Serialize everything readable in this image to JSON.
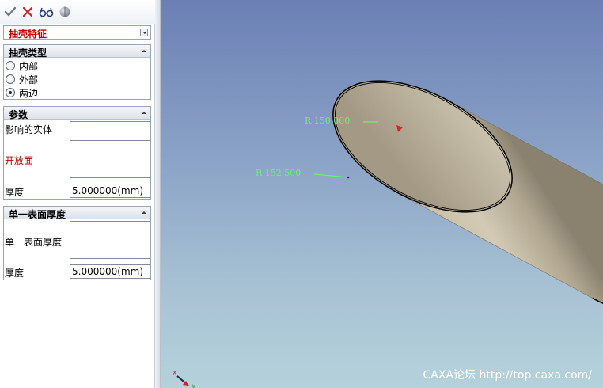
{
  "toolbar": {
    "buttons": [
      {
        "icon": "check-icon",
        "color": "#6b7a87"
      },
      {
        "icon": "close-icon",
        "color": "#cc2222"
      },
      {
        "icon": "preview-glasses-icon",
        "color": "#1e3c8a"
      },
      {
        "icon": "shade-sphere-icon",
        "color": "#8a8f99"
      }
    ]
  },
  "feature": {
    "title": "抽壳特征"
  },
  "shell_type": {
    "header": "抽壳类型",
    "options": [
      {
        "label": "内部",
        "selected": false
      },
      {
        "label": "外部",
        "selected": false
      },
      {
        "label": "两边",
        "selected": true
      }
    ]
  },
  "params": {
    "header": "参数",
    "affected_label": "影响的实体",
    "affected_value": "",
    "open_face_label": "开放面",
    "open_face_value": "",
    "thickness_label": "厚度",
    "thickness_value": "5.000000(mm)"
  },
  "single_surface": {
    "header": "单一表面厚度",
    "surface_label": "单一表面厚度",
    "surface_value": "",
    "thickness_label": "厚度",
    "thickness_value": "5.000000(mm)"
  },
  "viewport": {
    "dimensions": [
      {
        "text": "R 150.000"
      },
      {
        "text": "R 152.500"
      }
    ],
    "axis_x_label": "x",
    "axis_y_label": "y",
    "watermark": "CAXA论坛 http://top.caxa.com/",
    "colors": {
      "dimension_text": "#6bf07a",
      "open_face_label": "#c00000",
      "feature_title": "#c00000"
    }
  }
}
